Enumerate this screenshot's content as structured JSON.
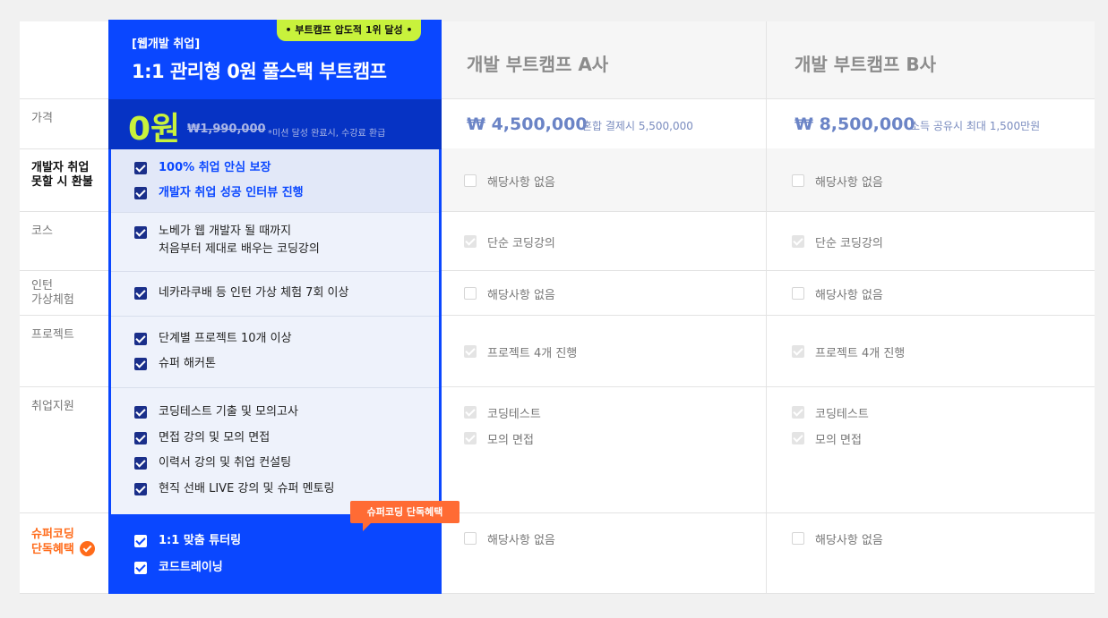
{
  "labels": {
    "price": "가격",
    "refund_l1": "개발자 취업",
    "refund_l2": "못할 시 환불",
    "course": "코스",
    "intern_l1": "인턴",
    "intern_l2": "가상체험",
    "project": "프로젝트",
    "jobsupport": "취업지원",
    "exclusive_l1": "슈퍼코딩",
    "exclusive_l2": "단독혜택"
  },
  "highlight": {
    "badge": "• 부트캠프 압도적 1위 달성 •",
    "category": "[웹개발 취업]",
    "title": "1:1 관리형 0원 풀스택 부트캠프",
    "price": "0원",
    "price_old": "₩1,990,000",
    "price_note": "*미션 달성 완료시, 수강료 환급",
    "refund": [
      "100% 취업 안심 보장",
      "개발자 취업 성공 인터뷰 진행"
    ],
    "course_l1": "노베가 웹 개발자 될 때까지",
    "course_l2": "처음부터 제대로 배우는 코딩강의",
    "intern": "네카라쿠배 등 인턴 가상 체험 7회 이상",
    "project": [
      "단계별 프로젝트 10개 이상",
      "슈퍼 해커톤"
    ],
    "jobsupport": [
      "코딩테스트 기출 및 모의고사",
      "면접 강의 및 모의 면접",
      "이력서 강의 및 취업 컨설팅",
      "현직 선배 LIVE 강의 및 슈퍼 멘토링"
    ],
    "tooltip": "슈퍼코딩 단독혜택",
    "exclusive": [
      "1:1 맞춤 튜터링",
      "코드트레이닝"
    ]
  },
  "compA": {
    "title": "개발 부트캠프 A사",
    "price": "₩ 4,500,000",
    "price_note": "혼합 결제시 5,500,000",
    "refund": "해당사항 없음",
    "course": "단순 코딩강의",
    "intern": "해당사항 없음",
    "project": "프로젝트 4개 진행",
    "jobsupport": [
      "코딩테스트",
      "모의 면접"
    ],
    "exclusive": "해당사항 없음"
  },
  "compB": {
    "title": "개발 부트캠프 B사",
    "price": "₩ 8,500,000",
    "price_note": "소득 공유시 최대 1,500만원",
    "refund": "해당사항 없음",
    "course": "단순 코딩강의",
    "intern": "해당사항 없음",
    "project": "프로젝트 4개 진행",
    "jobsupport": [
      "코딩테스트",
      "모의 면접"
    ],
    "exclusive": "해당사항 없음"
  }
}
